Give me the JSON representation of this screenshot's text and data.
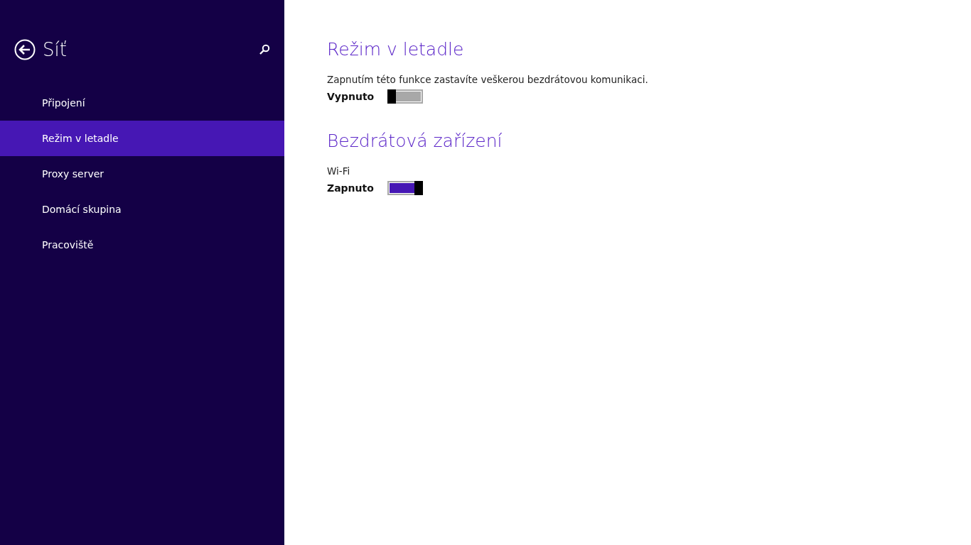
{
  "sidebar": {
    "title": "Síť",
    "items": [
      {
        "label": "Připojení",
        "selected": false
      },
      {
        "label": "Režim v letadle",
        "selected": true
      },
      {
        "label": "Proxy server",
        "selected": false
      },
      {
        "label": "Domácí skupina",
        "selected": false
      },
      {
        "label": "Pracoviště",
        "selected": false
      }
    ]
  },
  "sections": [
    {
      "heading": "Režim v letadle",
      "settings": [
        {
          "label": "Zapnutím této funkce zastavíte veškerou bezdrátovou komunikaci.",
          "state_text": "Vypnuto",
          "on": false
        }
      ]
    },
    {
      "heading": "Bezdrátová zařízení",
      "settings": [
        {
          "label": "Wi-Fi",
          "state_text": "Zapnuto",
          "on": true
        }
      ]
    }
  ]
}
